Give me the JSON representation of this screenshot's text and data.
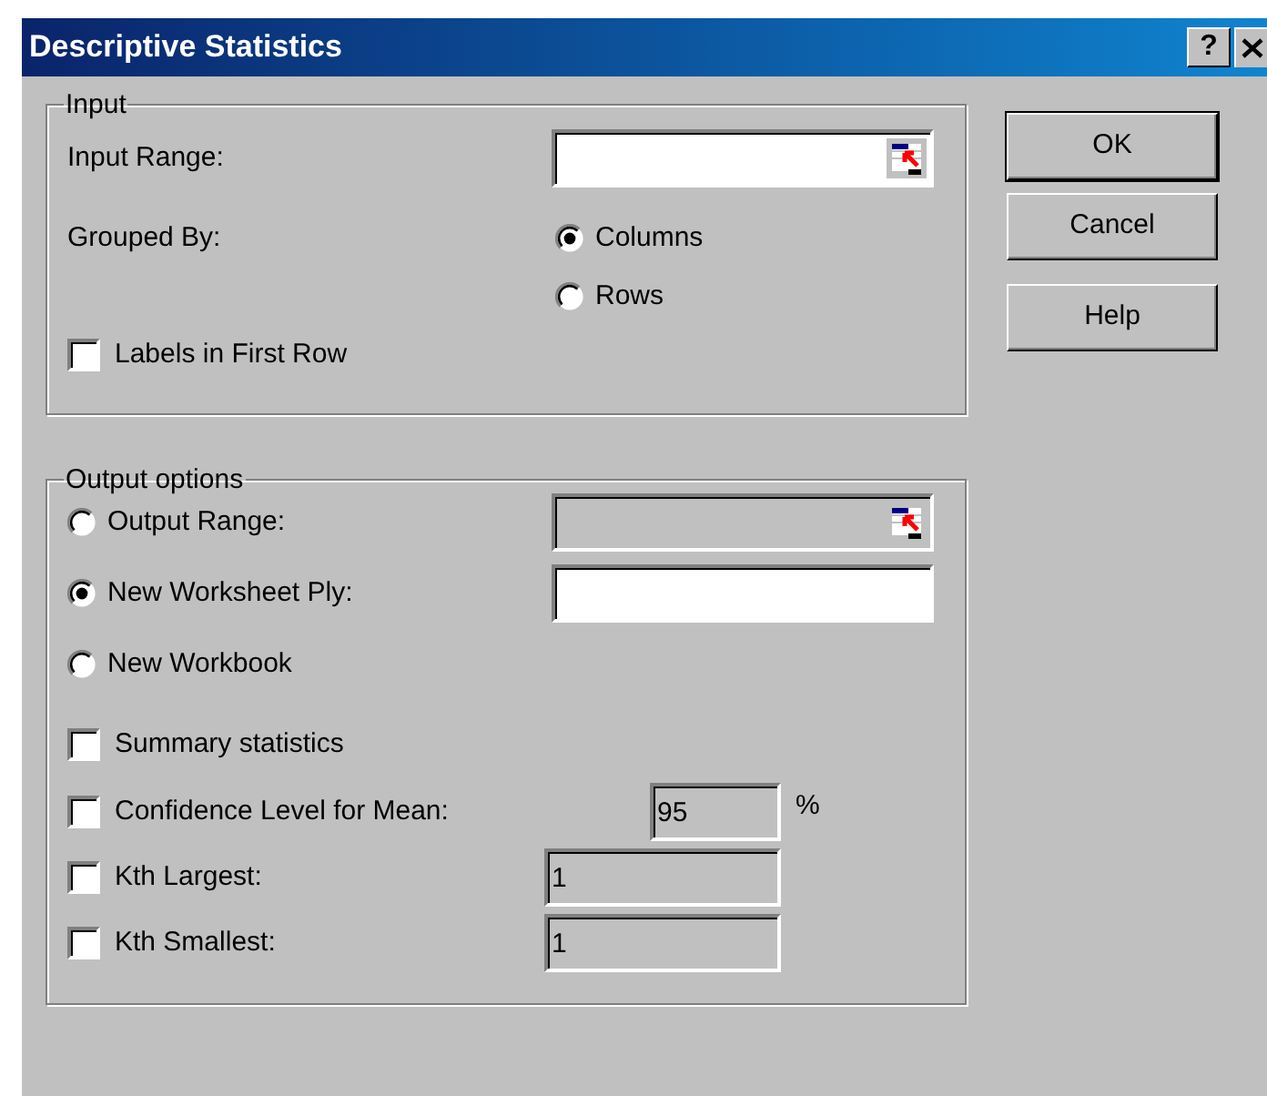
{
  "window": {
    "title": "Descriptive Statistics",
    "help_button": "?"
  },
  "input": {
    "title": "Input",
    "input_range": {
      "label": "Input Range:"
    },
    "grouped_by": {
      "label": "Grouped By:",
      "options": [
        {
          "label": "Columns",
          "selected": true
        },
        {
          "label": "Rows",
          "selected": false
        }
      ]
    },
    "labels_in_first_row": {
      "label": "Labels in First Row",
      "checked": false
    }
  },
  "output": {
    "title": "Output options",
    "destinations": [
      {
        "label": "Output Range:",
        "selected": false,
        "field": {
          "disabled": true,
          "picker": true
        }
      },
      {
        "label": "New Worksheet Ply:",
        "selected": true,
        "field": {
          "disabled": false,
          "picker": false
        }
      },
      {
        "label": "New Workbook",
        "selected": false
      }
    ],
    "statistics": [
      {
        "kind": "plain",
        "label": "Summary statistics",
        "checked": false
      },
      {
        "kind": "percent",
        "label": "Confidence Level for Mean:",
        "checked": false,
        "value": "95",
        "unit": "%"
      },
      {
        "kind": "number",
        "label": "Kth Largest:",
        "checked": false,
        "value": "1"
      },
      {
        "kind": "number",
        "label": "Kth Smallest:",
        "checked": false,
        "value": "1"
      }
    ]
  },
  "buttons": [
    {
      "label": "OK",
      "default": true
    },
    {
      "label": "Cancel",
      "default": false
    },
    {
      "label": "Help",
      "default": false
    }
  ]
}
